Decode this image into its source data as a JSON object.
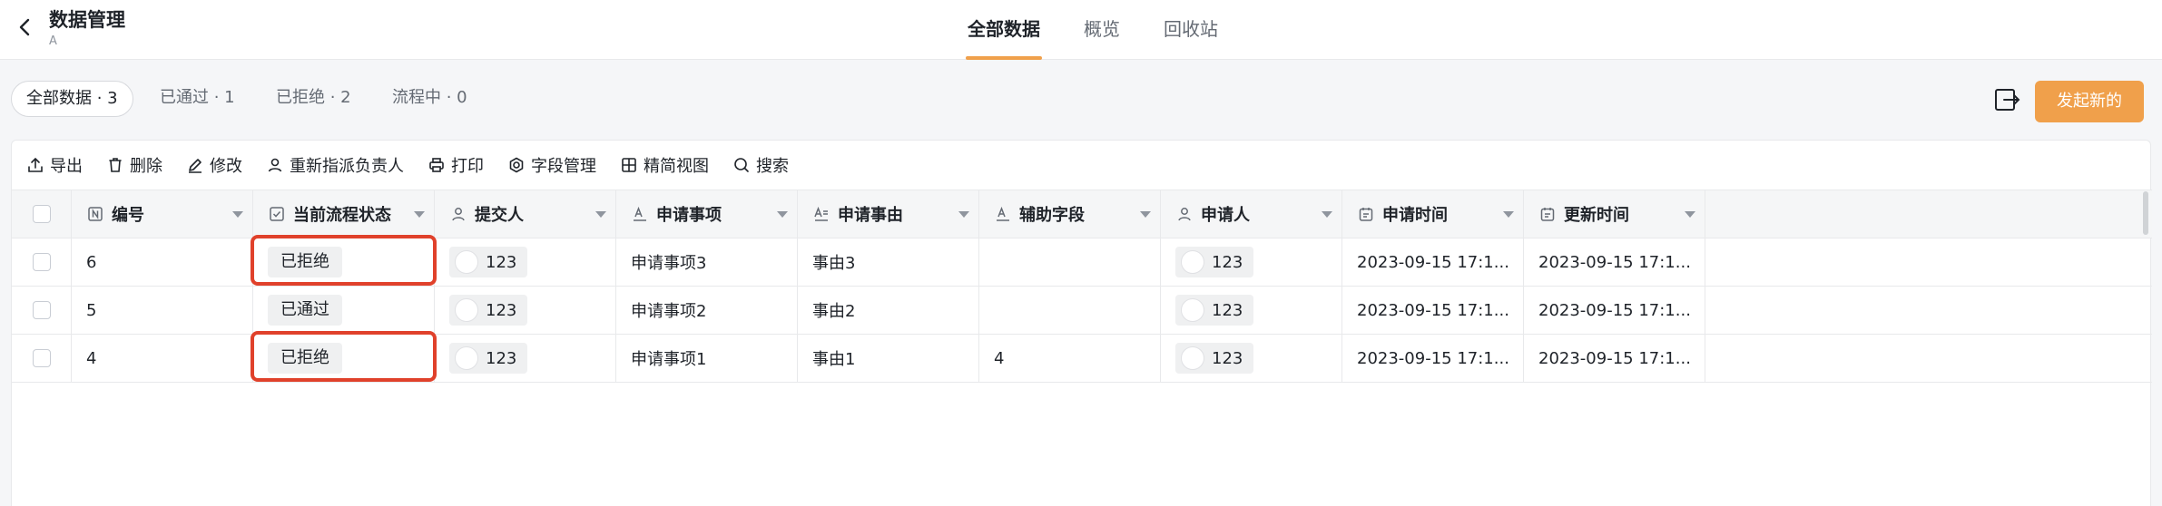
{
  "header": {
    "title": "数据管理",
    "subtitle": "A"
  },
  "main_tabs": [
    {
      "label": "全部数据",
      "active": true
    },
    {
      "label": "概览",
      "active": false
    },
    {
      "label": "回收站",
      "active": false
    }
  ],
  "filters": [
    {
      "label": "全部数据 · 3",
      "active": true
    },
    {
      "label": "已通过 · 1",
      "active": false
    },
    {
      "label": "已拒绝 · 2",
      "active": false
    },
    {
      "label": "流程中 · 0",
      "active": false
    }
  ],
  "primary_button": "发起新的",
  "toolbar": [
    {
      "label": "导出",
      "icon": "export-icon"
    },
    {
      "label": "删除",
      "icon": "trash-icon"
    },
    {
      "label": "修改",
      "icon": "edit-icon"
    },
    {
      "label": "重新指派负责人",
      "icon": "person-icon"
    },
    {
      "label": "打印",
      "icon": "printer-icon"
    },
    {
      "label": "字段管理",
      "icon": "settings-icon"
    },
    {
      "label": "精简视图",
      "icon": "grid-icon"
    },
    {
      "label": "搜索",
      "icon": "search-icon"
    }
  ],
  "table": {
    "columns": [
      {
        "label": "编号",
        "icon": "number-field-icon"
      },
      {
        "label": "当前流程状态",
        "icon": "checkbox-field-icon"
      },
      {
        "label": "提交人",
        "icon": "person-field-icon"
      },
      {
        "label": "申请事项",
        "icon": "text-field-icon"
      },
      {
        "label": "申请事由",
        "icon": "multiline-text-field-icon"
      },
      {
        "label": "辅助字段",
        "icon": "text-field-icon"
      },
      {
        "label": "申请人",
        "icon": "person-field-icon"
      },
      {
        "label": "申请时间",
        "icon": "date-field-icon"
      },
      {
        "label": "更新时间",
        "icon": "date-field-icon"
      }
    ],
    "rows": [
      {
        "id": "6",
        "status": "已拒绝",
        "submitter": "123",
        "item": "申请事项3",
        "reason": "事由3",
        "aux": "",
        "applicant": "123",
        "apply_time": "2023-09-15 17:1...",
        "update_time": "2023-09-15 17:1...",
        "highlighted": true
      },
      {
        "id": "5",
        "status": "已通过",
        "submitter": "123",
        "item": "申请事项2",
        "reason": "事由2",
        "aux": "",
        "applicant": "123",
        "apply_time": "2023-09-15 17:1...",
        "update_time": "2023-09-15 17:1...",
        "highlighted": false
      },
      {
        "id": "4",
        "status": "已拒绝",
        "submitter": "123",
        "item": "申请事项1",
        "reason": "事由1",
        "aux": "4",
        "applicant": "123",
        "apply_time": "2023-09-15 17:1...",
        "update_time": "2023-09-15 17:1...",
        "highlighted": true
      }
    ]
  },
  "colors": {
    "accent": "#f0a04b",
    "highlight": "#e0412b"
  }
}
